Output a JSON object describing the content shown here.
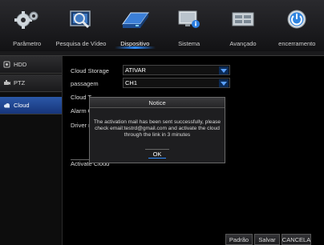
{
  "nav": {
    "items": [
      {
        "label": "Parâmetro",
        "icon": "gears-icon"
      },
      {
        "label": "Pesquisa de Vídeo",
        "icon": "search-video-icon"
      },
      {
        "label": "Dispositivo",
        "icon": "hard-drive-icon"
      },
      {
        "label": "Sistema",
        "icon": "monitor-info-icon"
      },
      {
        "label": "Avançado",
        "icon": "advanced-panel-icon"
      },
      {
        "label": "encerramento",
        "icon": "power-icon"
      }
    ],
    "active_index": 2
  },
  "sidebar": {
    "items": [
      {
        "label": "HDD",
        "icon": "hdd-icon"
      },
      {
        "label": "PTZ",
        "icon": "ptz-camera-icon"
      },
      {
        "label": "Cloud",
        "icon": "cloud-icon"
      }
    ],
    "active_index": 2
  },
  "form": {
    "cloud_storage_label": "Cloud Storage",
    "cloud_storage_value": "ATIVAR",
    "passagem_label": "passagem",
    "passagem_value": "CH1",
    "cloud_type_label": "Cloud T",
    "alarm_label": "Alarm C",
    "driver_label": "Driver n",
    "activate_label": "Activate Cloud"
  },
  "bottom_buttons": {
    "default_label": "Padrão",
    "save_label": "Salvar",
    "cancel_label": "CANCELA"
  },
  "modal": {
    "title": "Notice",
    "message_line1": "The activation mail has been sent successfully, please",
    "message_line2": "check email:testrd@gmail.com and activate the cloud",
    "message_line3": "through the link in 3 minutes",
    "ok_label": "OK"
  },
  "colors": {
    "accent_blue": "#2f8cff",
    "active_sidebar": "#2b58a8",
    "background": "#000000"
  }
}
